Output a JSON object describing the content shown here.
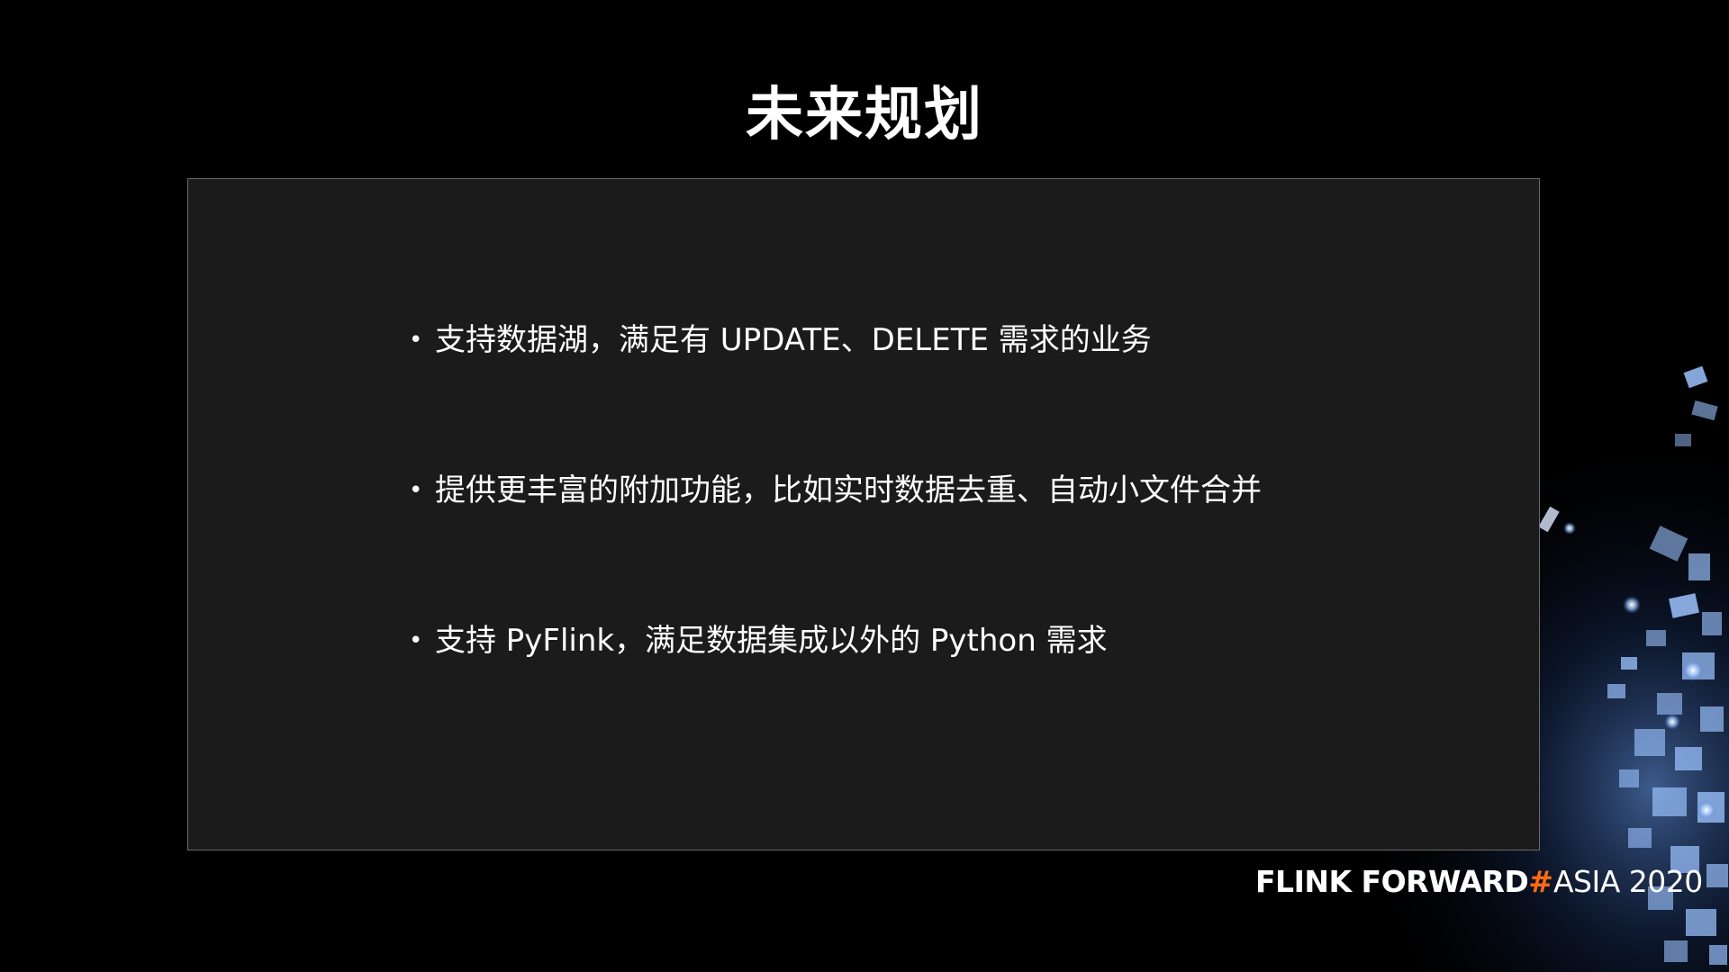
{
  "slide": {
    "title": "未来规划",
    "bullets": [
      "支持数据湖，满足有 UPDATE、DELETE 需求的业务",
      "提供更丰富的附加功能，比如实时数据去重、自动小文件合并",
      "支持 PyFlink，满足数据集成以外的 Python 需求"
    ]
  },
  "brand": {
    "part1": "FLINK FORWARD",
    "hash": "#",
    "part2": "ASIA 2020",
    "accent_color": "#ff6a13"
  },
  "theme": {
    "background": "#000000",
    "panel": "#1b1b1b",
    "panel_border": "#6a6a6a",
    "glow": "#7fb2ff"
  }
}
